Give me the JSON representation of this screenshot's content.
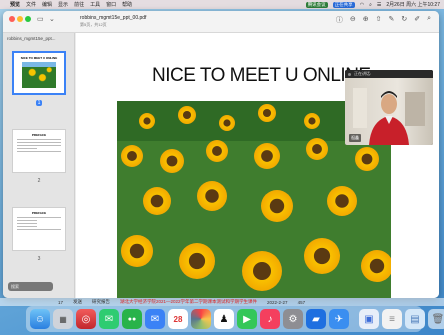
{
  "menubar": {
    "apple": "",
    "items": [
      "预览",
      "文件",
      "编辑",
      "显示",
      "前往",
      "工具",
      "窗口",
      "帮助"
    ],
    "recording_label": "腾讯会议",
    "share_label": "正在共享",
    "clock": "2月26日 周六 上午10:27"
  },
  "window": {
    "doc_title": "robbins_mgmt15e_ppt_00.pdf",
    "doc_subtitle": "第5页，共12页"
  },
  "sidebar": {
    "header": "robbins_mgmt15e_ppt...",
    "thumb1_title": "NICE TO MEET U ONLINE",
    "thumb2_head": "PREFACE",
    "thumb3_head": "PREFACE",
    "pages": [
      "1",
      "2",
      "3"
    ],
    "search_placeholder": "搜索"
  },
  "slide": {
    "heading": "NICE TO MEET U ONLINE"
  },
  "video": {
    "top_label": "正在讲话:",
    "name": "祖鑫"
  },
  "status": {
    "left_num": "17",
    "left_label": "发送",
    "mid_label": "研究报告",
    "center_text": "湖北大学经济学院2021—2022学年第二学期课本测试和学期学生课件",
    "date": "2022-2-27",
    "right_num": "457"
  },
  "dock": {
    "icons": [
      "finder-icon",
      "launchpad-icon",
      "safari-icon",
      "messages-icon",
      "wechat-icon",
      "mail-icon",
      "calendar-icon",
      "photos-icon",
      "qq-icon",
      "facetime-icon",
      "music-icon",
      "settings-icon",
      "tencent-meeting-icon",
      "lark-icon",
      "preview-icon",
      "notes-icon",
      "files-icon",
      "trash-icon"
    ],
    "calendar_date": "28"
  }
}
